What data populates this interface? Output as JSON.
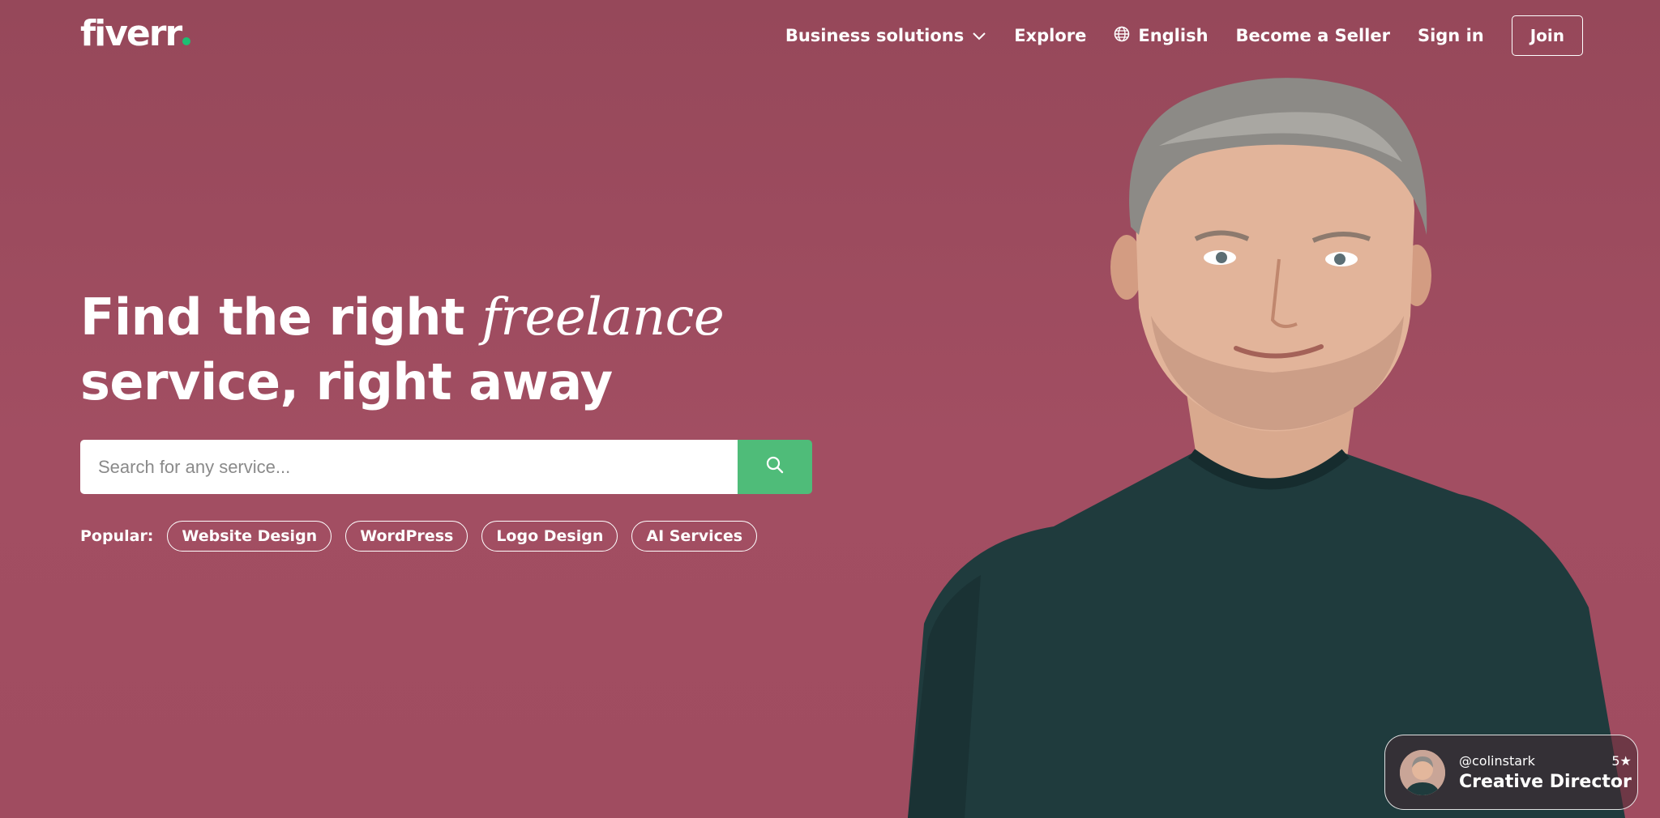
{
  "brand": {
    "logo_text": "fiverr",
    "accent_color": "#1dbf73",
    "search_button_color": "#4fbc79",
    "background_color": "#9a4a5a"
  },
  "nav": {
    "business_solutions": "Business solutions",
    "explore": "Explore",
    "language": "English",
    "become_seller": "Become a Seller",
    "sign_in": "Sign in",
    "join": "Join"
  },
  "hero": {
    "headline_part1": "Find the right",
    "headline_italic": "freelance",
    "headline_part2": "service, right away"
  },
  "search": {
    "placeholder": "Search for any service..."
  },
  "popular": {
    "label": "Popular:",
    "chips": [
      "Website Design",
      "WordPress",
      "Logo Design",
      "AI Services"
    ]
  },
  "seller_card": {
    "handle": "@colinstark",
    "rating": "5★",
    "role": "Creative Director"
  },
  "icons": {
    "chevron": "chevron-down-icon",
    "globe": "globe-icon",
    "search": "search-icon"
  }
}
